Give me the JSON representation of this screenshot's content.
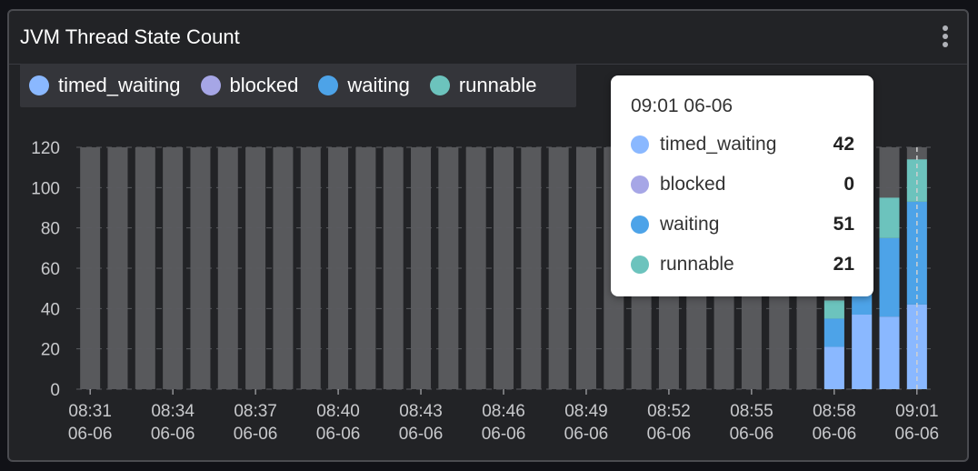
{
  "panel": {
    "title": "JVM Thread State Count",
    "menu_icon": "vertical-ellipsis-icon"
  },
  "legend": [
    {
      "name": "timed_waiting",
      "color": "#8ab8ff"
    },
    {
      "name": "blocked",
      "color": "#a6a6e6"
    },
    {
      "name": "waiting",
      "color": "#4da3e8"
    },
    {
      "name": "runnable",
      "color": "#6cc3bd"
    }
  ],
  "tooltip": {
    "title": "09:01 06-06",
    "rows": [
      {
        "name": "timed_waiting",
        "value": "42",
        "color": "#8ab8ff"
      },
      {
        "name": "blocked",
        "value": "0",
        "color": "#a6a6e6"
      },
      {
        "name": "waiting",
        "value": "51",
        "color": "#4da3e8"
      },
      {
        "name": "runnable",
        "value": "21",
        "color": "#6cc3bd"
      }
    ]
  },
  "chart_data": {
    "type": "bar",
    "stacked": true,
    "ylim": [
      0,
      120
    ],
    "yticks": [
      0,
      20,
      40,
      60,
      80,
      100,
      120
    ],
    "x_tick_labels": [
      [
        "08:31",
        "06-06"
      ],
      [
        "08:34",
        "06-06"
      ],
      [
        "08:37",
        "06-06"
      ],
      [
        "08:40",
        "06-06"
      ],
      [
        "08:43",
        "06-06"
      ],
      [
        "08:46",
        "06-06"
      ],
      [
        "08:49",
        "06-06"
      ],
      [
        "08:52",
        "06-06"
      ],
      [
        "08:55",
        "06-06"
      ],
      [
        "08:58",
        "06-06"
      ],
      [
        "09:01",
        "06-06"
      ]
    ],
    "tick_every": 3,
    "bar_count": 31,
    "series": [
      {
        "name": "timed_waiting",
        "color": "#8ab8ff",
        "values": [
          null,
          null,
          null,
          null,
          null,
          null,
          null,
          null,
          null,
          null,
          null,
          null,
          null,
          null,
          null,
          null,
          null,
          null,
          null,
          null,
          null,
          null,
          null,
          null,
          null,
          null,
          null,
          21,
          37,
          36,
          42
        ]
      },
      {
        "name": "blocked",
        "color": "#a6a6e6",
        "values": [
          null,
          null,
          null,
          null,
          null,
          null,
          null,
          null,
          null,
          null,
          null,
          null,
          null,
          null,
          null,
          null,
          null,
          null,
          null,
          null,
          null,
          null,
          null,
          null,
          null,
          null,
          null,
          0,
          0,
          0,
          0
        ]
      },
      {
        "name": "waiting",
        "color": "#4da3e8",
        "values": [
          null,
          null,
          null,
          null,
          null,
          null,
          null,
          null,
          null,
          null,
          null,
          null,
          null,
          null,
          null,
          null,
          null,
          null,
          null,
          null,
          null,
          null,
          null,
          null,
          null,
          null,
          null,
          14,
          25,
          39,
          51
        ]
      },
      {
        "name": "runnable",
        "color": "#6cc3bd",
        "values": [
          null,
          null,
          null,
          null,
          null,
          null,
          null,
          null,
          null,
          null,
          null,
          null,
          null,
          null,
          null,
          null,
          null,
          null,
          null,
          null,
          null,
          null,
          null,
          null,
          null,
          null,
          null,
          9,
          10,
          20,
          21
        ]
      }
    ],
    "highlight_index": 30,
    "colors": {
      "background_bar": "#58595c",
      "grid": "#5a5b60",
      "axis_text": "#c8c9cc",
      "crosshair": "#d0d0d0"
    },
    "grid": true,
    "legend_position": "top-left"
  }
}
